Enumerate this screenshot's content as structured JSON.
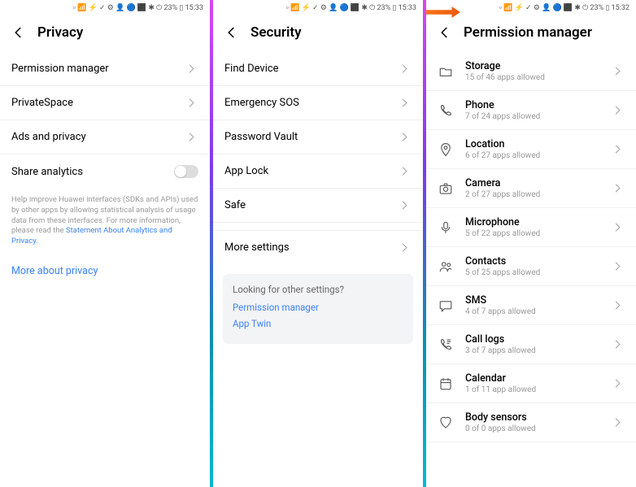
{
  "panel1": {
    "status": {
      "text": "▫ 📶 ⚡ ✓ ⚙ 👤 🔵  ⬛ ✱ ⏻ 23%  ▯ 15:33"
    },
    "title": "Privacy",
    "rows": [
      {
        "label": "Permission manager"
      },
      {
        "label": "PrivateSpace"
      },
      {
        "label": "Ads and privacy"
      }
    ],
    "share_analytics_label": "Share analytics",
    "help": {
      "body": "Help improve Huawei interfaces (SDKs and APIs) used by other apps by allowing statistical analysis of usage data from these interfaces. For more information, please read the ",
      "link": "Statement About Analytics and Privacy"
    },
    "more_link": "More about privacy"
  },
  "panel2": {
    "status": {
      "text": "▫ 📶 ⚡ ✓ ⚙ 👤 🔵  ⬛ ✱ ⏻ 23%  ▯ 15:33"
    },
    "title": "Security",
    "rows": [
      {
        "label": "Find Device"
      },
      {
        "label": "Emergency SOS"
      },
      {
        "label": "Password Vault"
      },
      {
        "label": "App Lock"
      },
      {
        "label": "Safe"
      },
      {
        "label": "More settings"
      }
    ],
    "info": {
      "title": "Looking for other settings?",
      "links": [
        "Permission manager",
        "App Twin"
      ]
    }
  },
  "panel3": {
    "status": {
      "text": "▫ 📶 ⚡ ✓ ⚙ 👤 🔵  ⬛ ✱ ⏻ 23%  ▯ 15:32"
    },
    "title": "Permission manager",
    "rows": [
      {
        "title": "Storage",
        "sub": "15 of 46 apps allowed"
      },
      {
        "title": "Phone",
        "sub": "7 of 24 apps allowed"
      },
      {
        "title": "Location",
        "sub": "6 of 27 apps allowed"
      },
      {
        "title": "Camera",
        "sub": "2 of 27 apps allowed"
      },
      {
        "title": "Microphone",
        "sub": "5 of 22 apps allowed"
      },
      {
        "title": "Contacts",
        "sub": "5 of 25 apps allowed"
      },
      {
        "title": "SMS",
        "sub": "4 of 7 apps allowed"
      },
      {
        "title": "Call logs",
        "sub": "3 of 7 apps allowed"
      },
      {
        "title": "Calendar",
        "sub": "1 of 11 app allowed"
      },
      {
        "title": "Body sensors",
        "sub": "0 of 0 apps allowed"
      }
    ]
  }
}
